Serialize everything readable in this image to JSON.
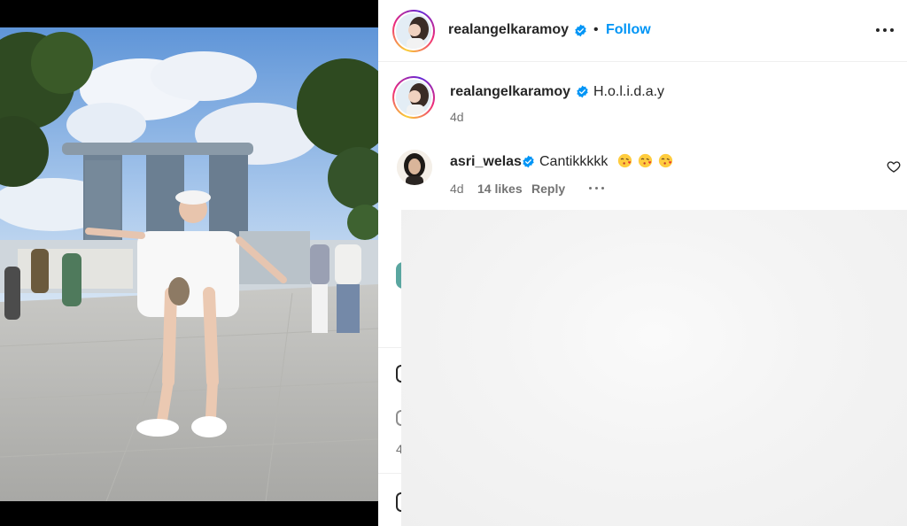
{
  "post": {
    "author": "realangelkaramoy",
    "separator": "•",
    "follow_label": "Follow",
    "caption": "H.o.l.i.d.a.y",
    "caption_time": "4d"
  },
  "comments": [
    {
      "username": "asri_welas",
      "text": "Cantikkkkk",
      "emojis": [
        "face-blowing-kiss-icon",
        "face-blowing-kiss-icon",
        "face-blowing-kiss-icon"
      ],
      "time": "4d",
      "likes": "14 likes",
      "reply_label": "Reply"
    }
  ],
  "partial_fragment": "4",
  "colors": {
    "follow_blue": "#0095f6",
    "verified_blue": "#0095f6",
    "muted_text": "#737373",
    "divider": "#efefef"
  }
}
